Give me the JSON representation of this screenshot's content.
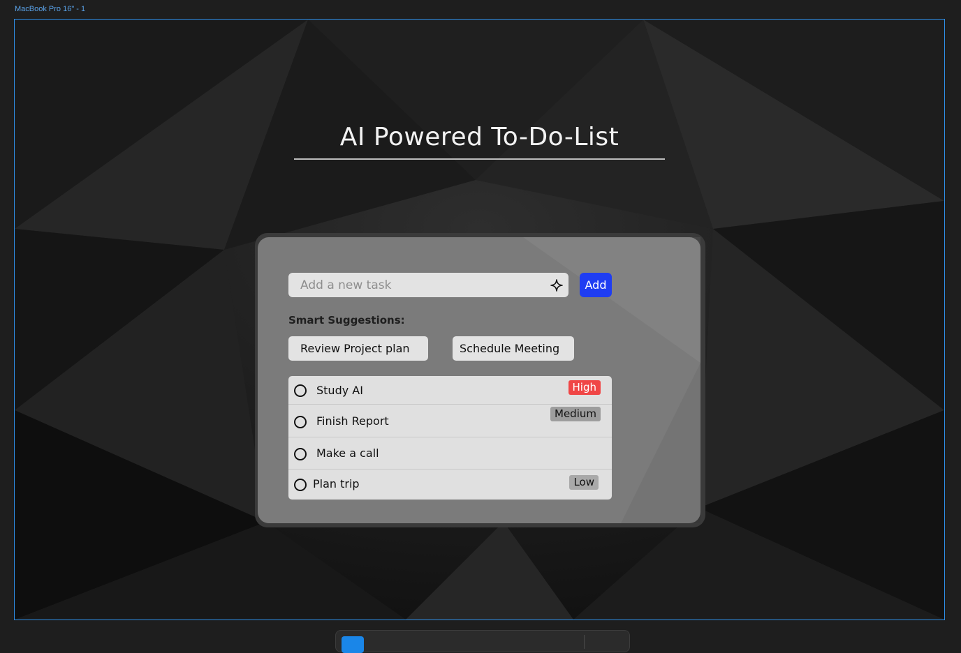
{
  "frame": {
    "label": "MacBook Pro 16\" - 1"
  },
  "app": {
    "title": "AI Powered To-Do-List",
    "input": {
      "placeholder": "Add a new task",
      "value": ""
    },
    "add_button": {
      "label": "Add"
    },
    "suggestions": {
      "label": "Smart Suggestions:",
      "items": [
        "Review Project plan",
        "Schedule Meeting"
      ]
    },
    "tasks": [
      {
        "name": "Study AI",
        "priority": "High",
        "done": false
      },
      {
        "name": "Finish Report",
        "priority": "Medium",
        "done": false
      },
      {
        "name": "Make a call",
        "priority": "",
        "done": false
      },
      {
        "name": "Plan trip",
        "priority": "Low",
        "done": false
      }
    ]
  },
  "colors": {
    "accent": "#1f3df2",
    "priority_high": "#f04646",
    "priority_medium": "#9d9d9d",
    "priority_low": "#a9a9a9",
    "frame_outline": "#2f8fe8"
  },
  "icons": {
    "input_action": "sparkle-icon",
    "task_status": "circle-outline-icon"
  }
}
